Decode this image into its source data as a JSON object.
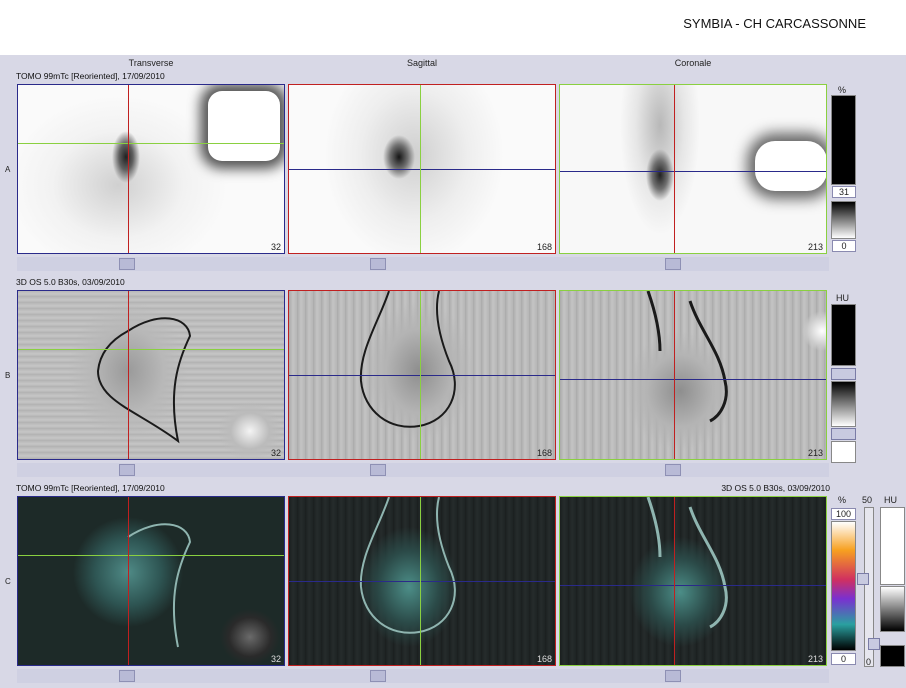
{
  "header": {
    "title": "SYMBIA - CH CARCASSONNE"
  },
  "columns": {
    "transverse": "Transverse",
    "sagittal": "Sagittal",
    "coronal": "Coronale"
  },
  "rows": {
    "a": {
      "letter": "A",
      "info": "TOMO 99mTc [Reoriented], 17/09/2010",
      "slices": [
        "32",
        "168",
        "213"
      ]
    },
    "b": {
      "letter": "B",
      "info": "3D  OS  5.0  B30s,  03/09/2010",
      "slices": [
        "32",
        "168",
        "213"
      ]
    },
    "c": {
      "letter": "C",
      "info": "TOMO 99mTc [Reoriented], 17/09/2010",
      "info_right": "3D  OS  5.0  B30s, 03/09/2010",
      "slices": [
        "32",
        "168",
        "213"
      ]
    }
  },
  "scales": {
    "a": {
      "unit": "%",
      "max": "31",
      "min": "0"
    },
    "b": {
      "unit": "HU"
    },
    "c": {
      "unit_left": "%",
      "max": "100",
      "min": "0",
      "mid_label": "50",
      "unit_right": "HU",
      "bottom_label": "0"
    }
  },
  "colors": {
    "workspace": "#d8d8e6",
    "transverse_border": "#2a2a8a",
    "sagittal_border": "#c02020",
    "coronal_border": "#8ad040"
  }
}
